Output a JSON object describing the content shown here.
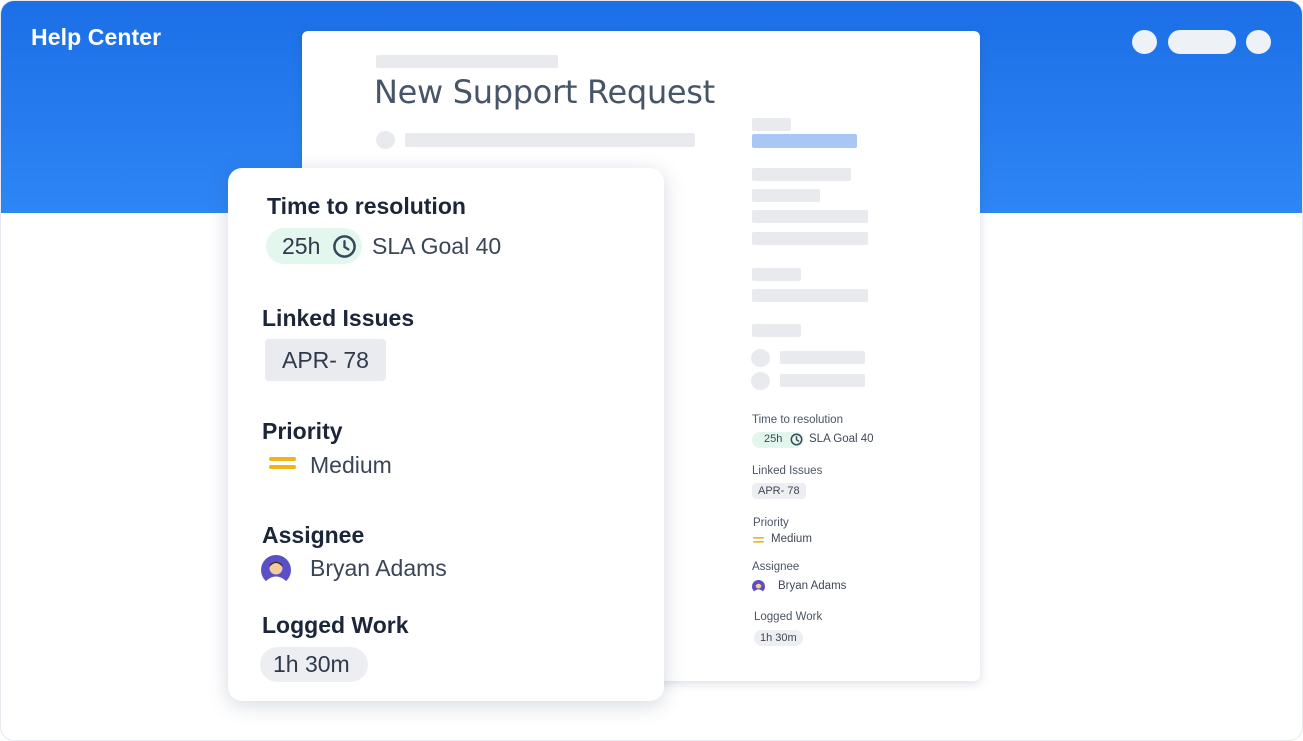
{
  "header": {
    "title": "Help Center"
  },
  "document": {
    "title": "New Support Request"
  },
  "summary_card": {
    "time_to_resolution": {
      "label": "Time to resolution",
      "hours": "25h",
      "sla_text": "SLA Goal 40"
    },
    "linked_issues": {
      "label": "Linked Issues",
      "issue": "APR- 78"
    },
    "priority": {
      "label": "Priority",
      "value": "Medium"
    },
    "assignee": {
      "label": "Assignee",
      "name": "Bryan Adams"
    },
    "logged_work": {
      "label": "Logged Work",
      "value": "1h 30m"
    }
  },
  "sidebar_mini": {
    "time_to_resolution": {
      "label": "Time to resolution",
      "hours": "25h",
      "sla_text": "SLA Goal 40"
    },
    "linked_issues": {
      "label": "Linked Issues",
      "issue": "APR- 78"
    },
    "priority": {
      "label": "Priority",
      "value": "Medium"
    },
    "assignee": {
      "label": "Assignee",
      "name": "Bryan Adams"
    },
    "logged_work": {
      "label": "Logged Work",
      "value": "1h 30m"
    }
  },
  "icons": [
    "clock-icon",
    "priority-medium-icon",
    "avatar",
    "connector-diamond"
  ],
  "colors": {
    "header_blue": "#2e86f5",
    "sla_green_bg": "#e3f7ee",
    "priority_yellow": "#f2b21a",
    "connector_purple": "#8b84f0",
    "accent_blue_placeholder": "#a9c7f4"
  }
}
